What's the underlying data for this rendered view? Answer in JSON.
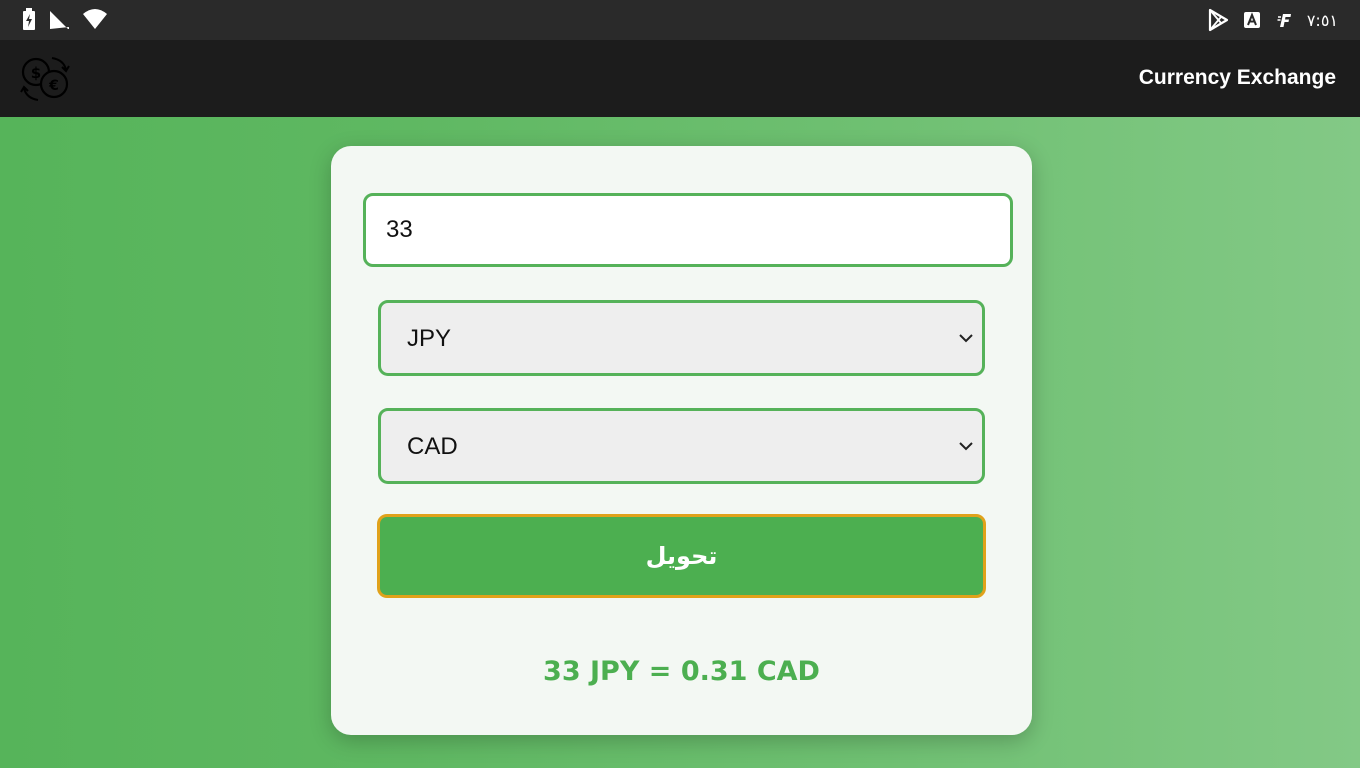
{
  "status_bar": {
    "time": "٧:٥١",
    "left_icons": [
      "battery-charging-icon",
      "signal-icon",
      "wifi-icon"
    ],
    "right_icons": [
      "play-store-icon",
      "keyboard-a-icon",
      "font-icon"
    ]
  },
  "app_bar": {
    "title": "Currency Exchange",
    "logo_icon": "currency-exchange-icon"
  },
  "form": {
    "amount_value": "33",
    "from_currency": "JPY",
    "to_currency": "CAD",
    "convert_label": "تحويل",
    "result": "33 JPY = 0.31 CAD"
  },
  "colors": {
    "accent": "#4caf50",
    "border": "#55b259",
    "button_border": "#e0a21a",
    "app_bar": "#1c1c1c",
    "status_bar": "#2a2a2a"
  }
}
